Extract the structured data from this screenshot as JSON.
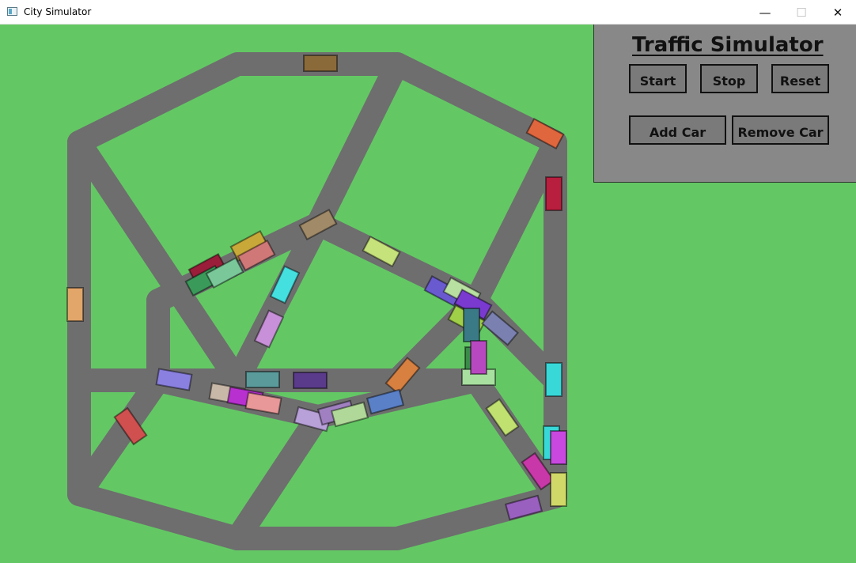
{
  "window": {
    "title": "City Simulator",
    "minimize_glyph": "—",
    "maximize_glyph": "☐",
    "close_glyph": "✕"
  },
  "panel": {
    "title": "Traffic Simulator",
    "start_label": "Start",
    "stop_label": "Stop",
    "reset_label": "Reset",
    "add_car_label": "Add Car",
    "remove_car_label": "Remove Car"
  },
  "colors": {
    "grass": "#63c864",
    "road": "#6e6e6e",
    "panel": "#888888"
  },
  "car_count": 44
}
